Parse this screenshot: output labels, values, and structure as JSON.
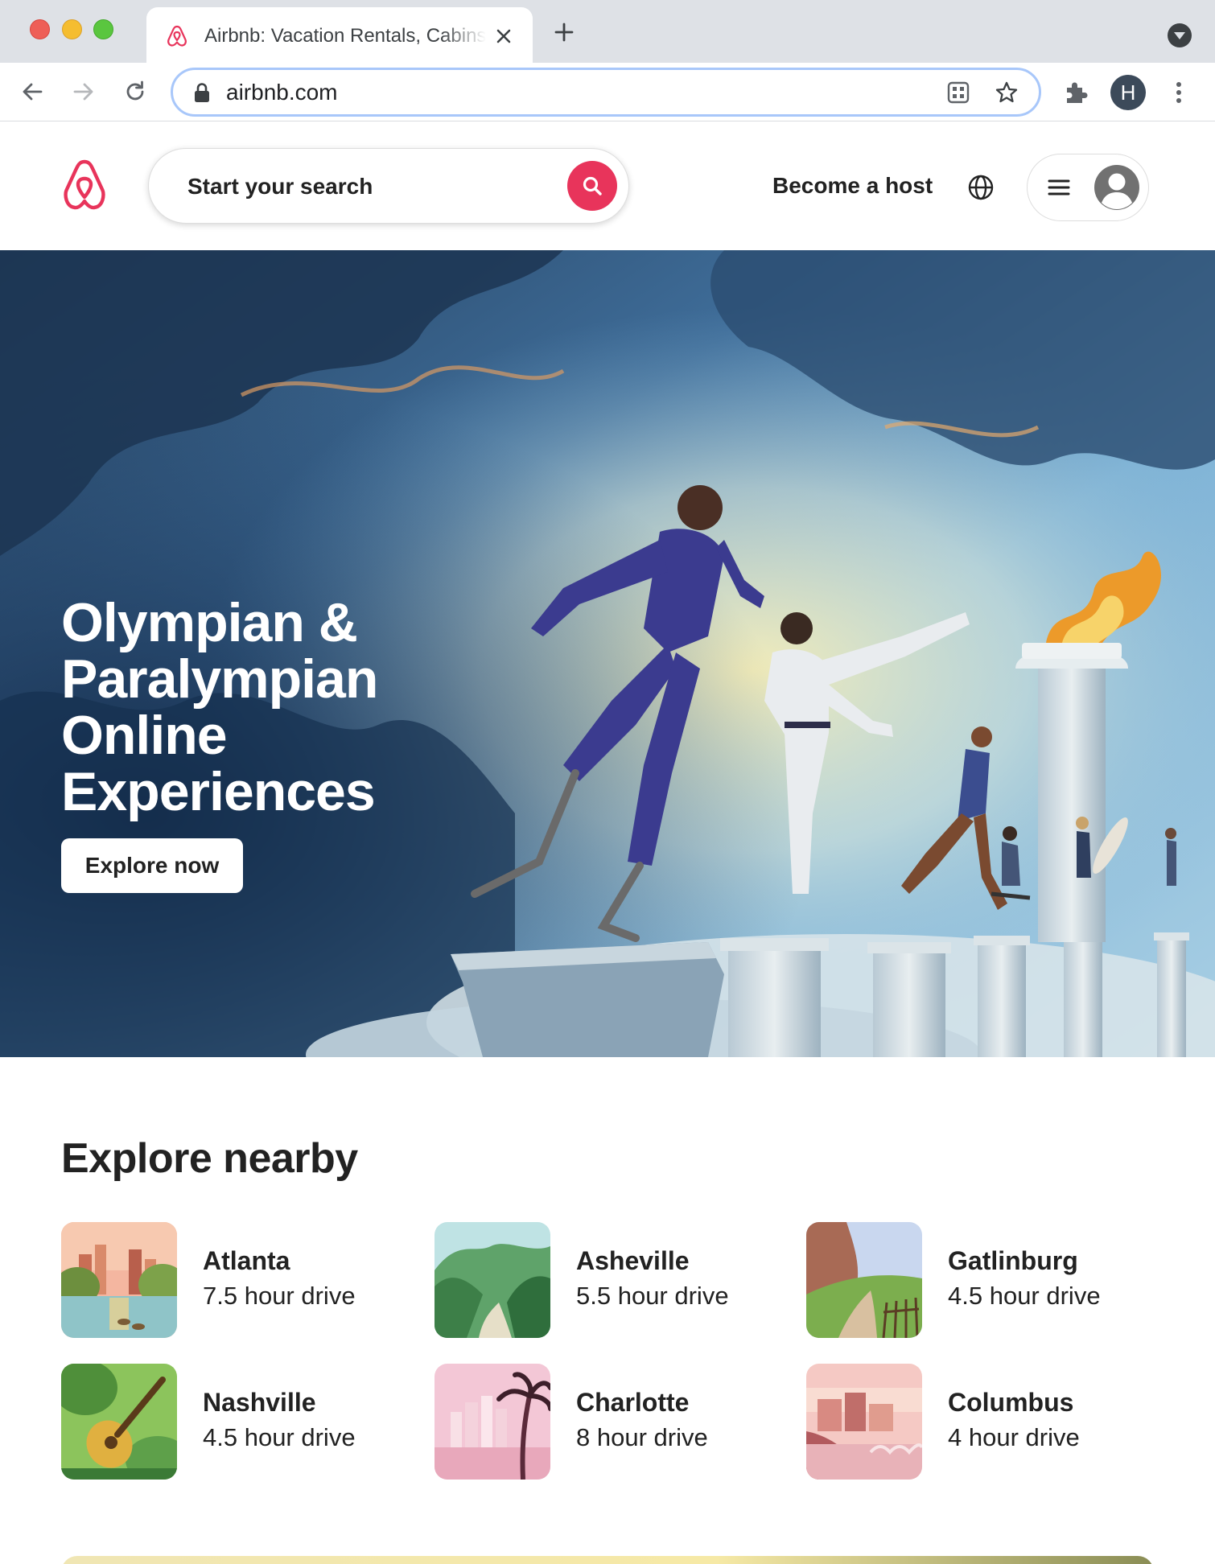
{
  "browser": {
    "tab_title": "Airbnb: Vacation Rentals, Cabins, Beach Houses",
    "url": "airbnb.com",
    "profile_initial": "H"
  },
  "header": {
    "search_placeholder": "Start your search",
    "become_host": "Become a host"
  },
  "hero": {
    "title": "Olympian & Paralympian Online Experiences",
    "cta": "Explore now"
  },
  "explore": {
    "title": "Explore nearby",
    "places": [
      {
        "name": "Atlanta",
        "drive": "7.5 hour drive"
      },
      {
        "name": "Asheville",
        "drive": "5.5 hour drive"
      },
      {
        "name": "Gatlinburg",
        "drive": "4.5 hour drive"
      },
      {
        "name": "Nashville",
        "drive": "4.5 hour drive"
      },
      {
        "name": "Charlotte",
        "drive": "8 hour drive"
      },
      {
        "name": "Columbus",
        "drive": "4 hour drive"
      }
    ]
  },
  "colors": {
    "brand": "#e8345b",
    "text": "#222222",
    "chrome": "#dee1e6"
  }
}
